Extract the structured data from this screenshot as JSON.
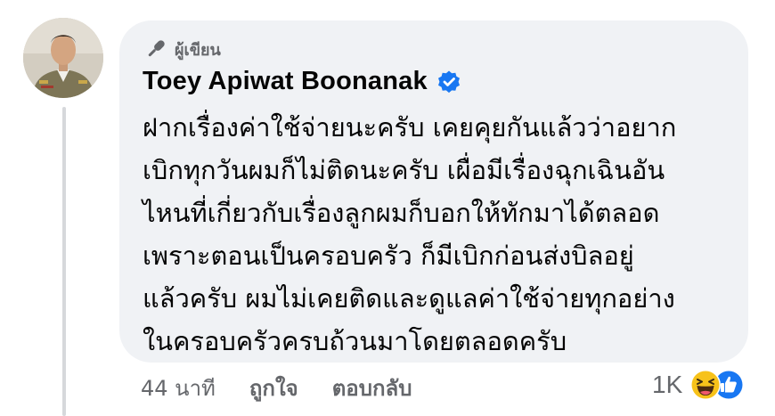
{
  "comment": {
    "author_badge": "ผู้เขียน",
    "author_name": "Toey Apiwat Boonanak",
    "verified": true,
    "text_lines": [
      "ฝากเรื่องค่าใช้จ่ายนะครับ เคยคุยกันแล้วว่าอยาก",
      "เบิกทุกวันผมก็ไม่ติดนะครับ เผื่อมีเรื่องฉุกเฉินอัน",
      "ไหนที่เกี่ยวกับเรื่องลูกผมก็บอกให้ทักมาได้ตลอด",
      "เพราะตอนเป็นครอบครัว ก็มีเบิกก่อนส่งบิลอยู่",
      "แล้วครับ ผมไม่เคยติดและดูแลค่าใช้จ่ายทุกอย่าง",
      "ในครอบครัวครบถ้วนมาโดยตลอดครับ"
    ]
  },
  "actions": {
    "timestamp": "44 นาที",
    "like_label": "ถูกใจ",
    "reply_label": "ตอบกลับ"
  },
  "reactions": {
    "count": "1K",
    "types": [
      "haha-icon",
      "like-icon"
    ]
  },
  "colors": {
    "bubble_bg": "#f0f2f5",
    "secondary_text": "#65676b",
    "primary_text": "#050505",
    "verified_blue": "#1877f2"
  }
}
